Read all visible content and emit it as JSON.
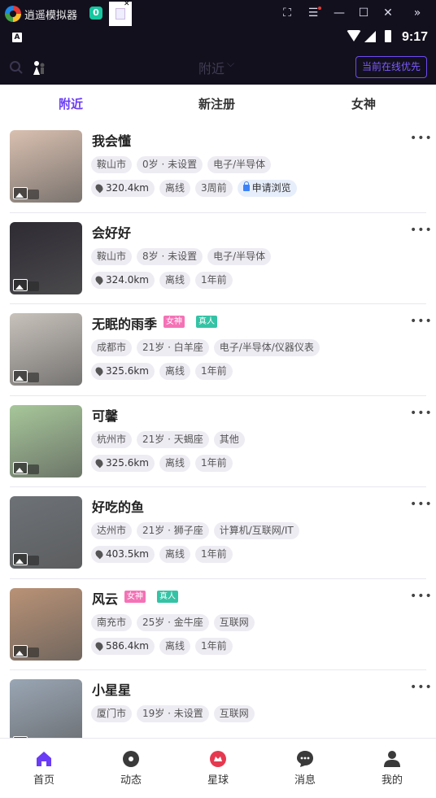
{
  "emulator": {
    "title": "逍遥模拟器",
    "tab_icon": "0",
    "controls": [
      "⛶",
      "☰",
      "—",
      "☐",
      "✕",
      "»"
    ]
  },
  "status": {
    "indicator": "A",
    "time": "9:17"
  },
  "appbar": {
    "title": "附近",
    "online_button": "当前在线优先"
  },
  "tabs": [
    {
      "label": "附近",
      "active": true
    },
    {
      "label": "新注册",
      "active": false
    },
    {
      "label": "女神",
      "active": false
    }
  ],
  "users": [
    {
      "name": "我会懂",
      "city": "鞍山市",
      "age": "0岁 · 未设置",
      "job": "电子/半导体",
      "distance": "320.4km",
      "status": "离线",
      "last": "3周前",
      "apply": "申请浏览",
      "goddess": false,
      "real": false,
      "thumb_color": "#d9c0b0"
    },
    {
      "name": "会好好",
      "city": "鞍山市",
      "age": "8岁 · 未设置",
      "job": "电子/半导体",
      "distance": "324.0km",
      "status": "离线",
      "last": "1年前",
      "goddess": false,
      "real": false,
      "thumb_color": "#2e2b33"
    },
    {
      "name": "无眠的雨季",
      "city": "成都市",
      "age": "21岁 · 白羊座",
      "job": "电子/半导体/仪器仪表",
      "distance": "325.6km",
      "status": "离线",
      "last": "1年前",
      "goddess": true,
      "real": true,
      "thumb_color": "#c8c2bb"
    },
    {
      "name": "可馨",
      "city": "杭州市",
      "age": "21岁 · 天蝎座",
      "job": "其他",
      "distance": "325.6km",
      "status": "离线",
      "last": "1年前",
      "goddess": false,
      "real": false,
      "thumb_color": "#a7c79a"
    },
    {
      "name": "好吃的鱼",
      "city": "达州市",
      "age": "21岁 · 狮子座",
      "job": "计算机/互联网/IT",
      "distance": "403.5km",
      "status": "离线",
      "last": "1年前",
      "goddess": false,
      "real": false,
      "thumb_color": "#6d7277"
    },
    {
      "name": "风云",
      "city": "南充市",
      "age": "25岁 · 金牛座",
      "job": "互联网",
      "distance": "586.4km",
      "status": "离线",
      "last": "1年前",
      "goddess": true,
      "real": true,
      "thumb_color": "#b99276"
    },
    {
      "name": "小星星",
      "city": "厦门市",
      "age": "19岁 · 未设置",
      "job": "互联网",
      "distance": "",
      "status": "",
      "last": "",
      "goddess": false,
      "real": false,
      "thumb_color": "#9aa6b4"
    }
  ],
  "badges": {
    "goddess": "女神",
    "real": "真人"
  },
  "nav": [
    {
      "label": "首页",
      "icon": "home-icon",
      "active": true
    },
    {
      "label": "动态",
      "icon": "moment-icon",
      "active": false
    },
    {
      "label": "星球",
      "icon": "planet-icon",
      "active": false
    },
    {
      "label": "消息",
      "icon": "message-icon",
      "active": false
    },
    {
      "label": "我的",
      "icon": "profile-icon",
      "active": false
    }
  ],
  "colors": {
    "accent": "#6a3cf5",
    "dark": "#13101d",
    "goddess": "#f472b6",
    "real": "#34c3a5"
  }
}
